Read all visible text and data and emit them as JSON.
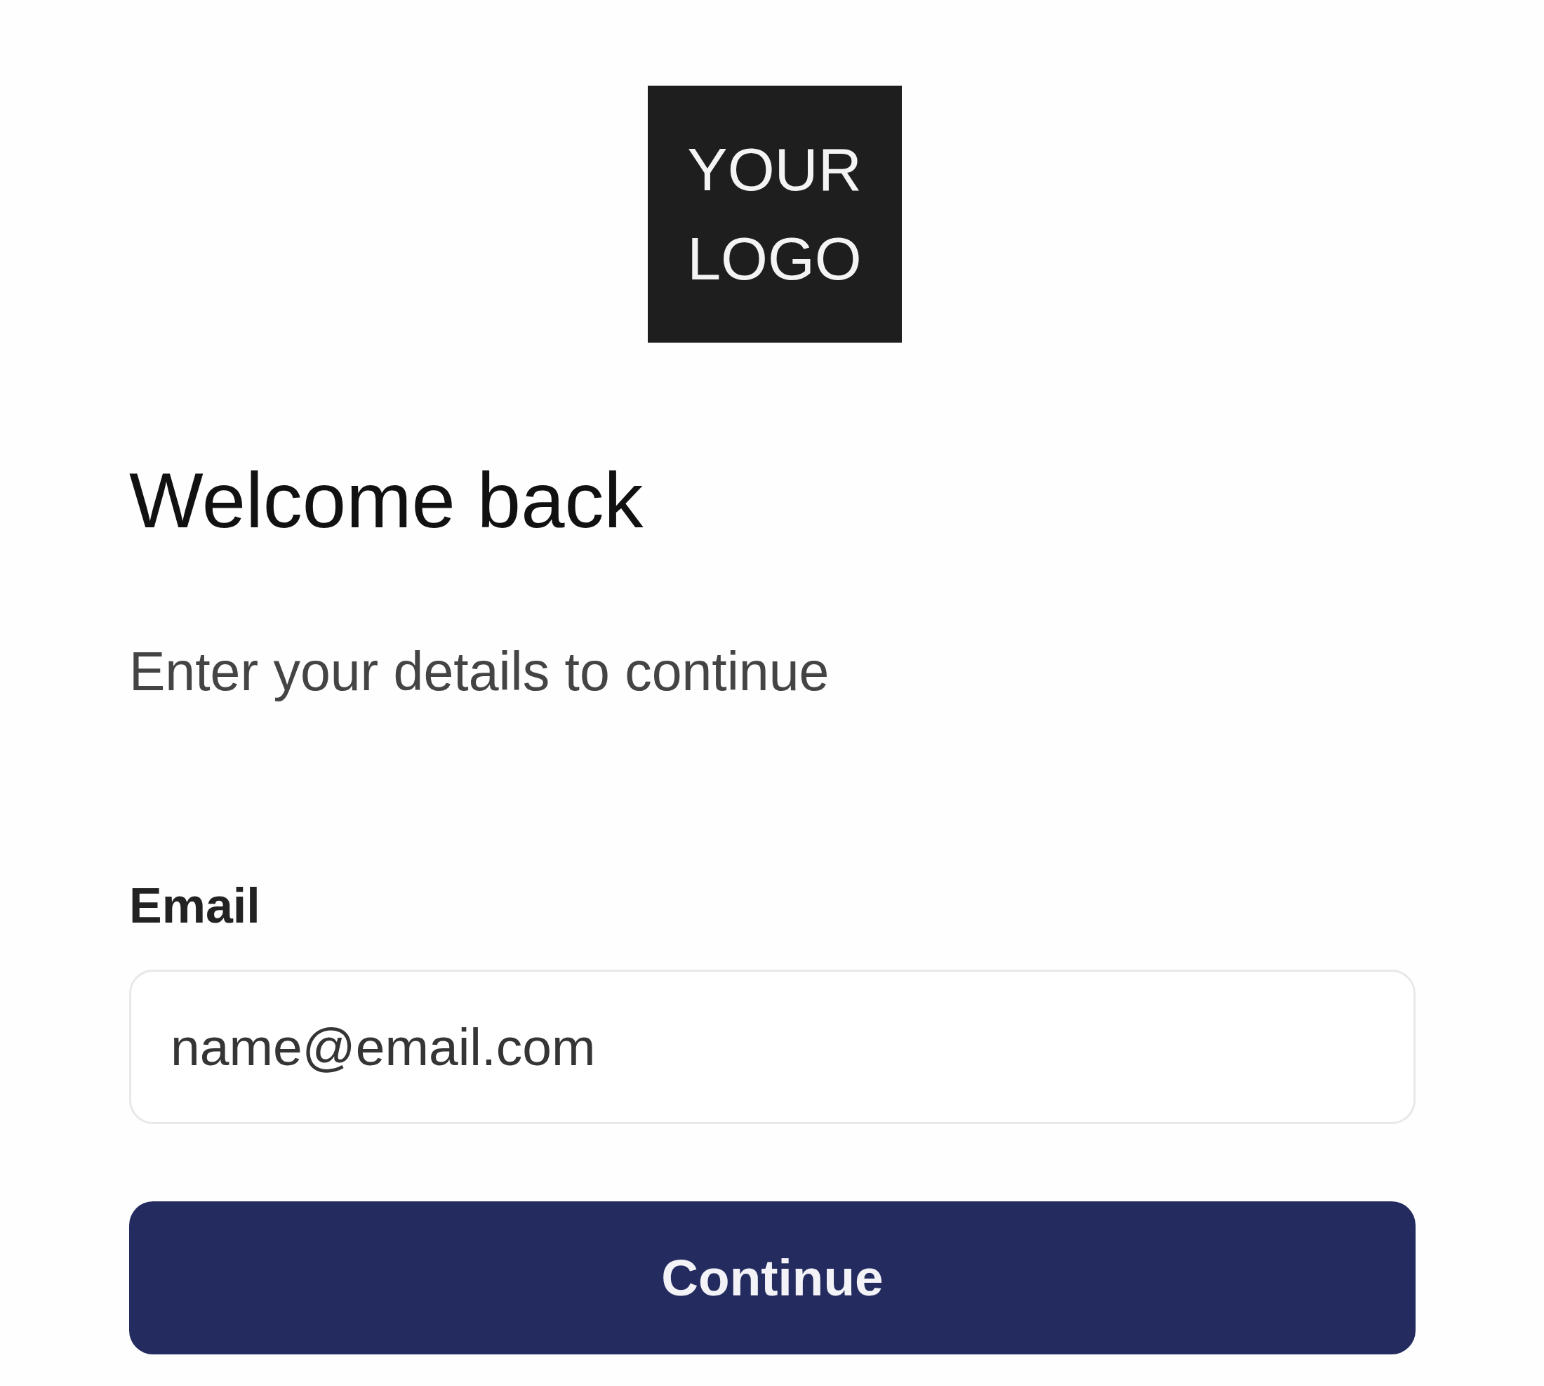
{
  "logo": {
    "text": "YOUR LOGO"
  },
  "heading": "Welcome back",
  "subtitle": "Enter your details to continue",
  "email_field": {
    "label": "Email",
    "placeholder": "name@email.com"
  },
  "submit_button": {
    "label": "Continue"
  }
}
